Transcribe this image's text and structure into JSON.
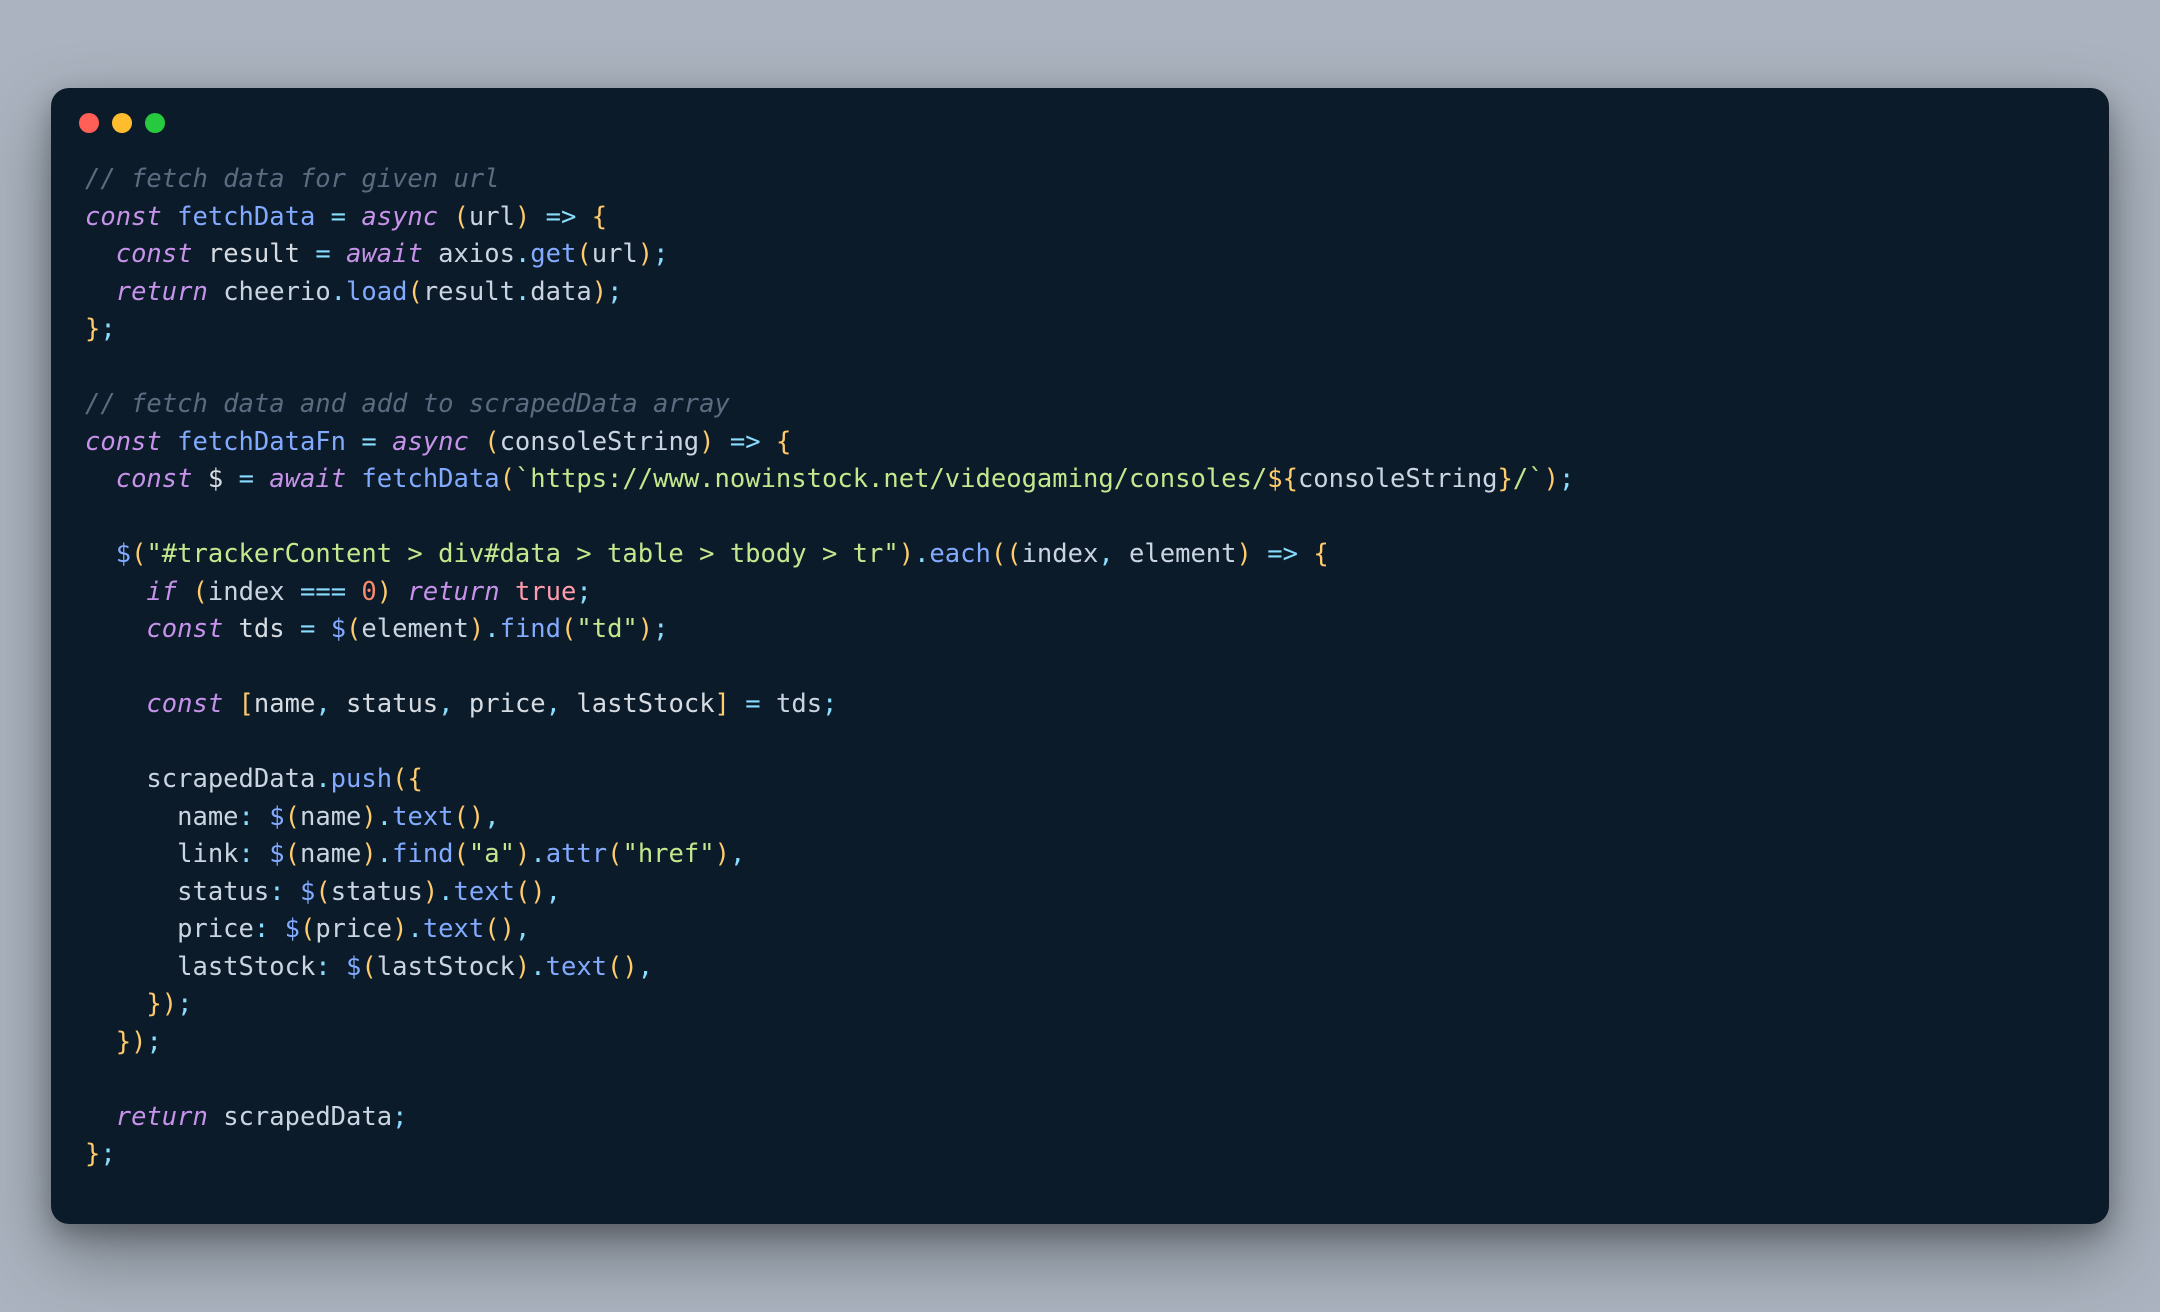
{
  "window": {
    "traffic_lights": [
      "close",
      "minimize",
      "zoom"
    ]
  },
  "code": {
    "c1": "// fetch data for given url",
    "kw_const": "const",
    "kw_async": "async",
    "kw_await": "await",
    "kw_return": "return",
    "kw_if": "if",
    "fn_fetchData": "fetchData",
    "var_url": "url",
    "arrow": "=>",
    "var_result": "result",
    "id_axios": "axios",
    "m_get": "get",
    "id_cheerio": "cheerio",
    "m_load": "load",
    "prop_data": "data",
    "c2": "// fetch data and add to scrapedData array",
    "fn_fetchDataFn": "fetchDataFn",
    "var_consoleString": "consoleString",
    "var_dollar": "$",
    "str_url_a": "https://www.nowinstock.net/videogaming/consoles/",
    "str_url_b": "/",
    "str_selector": "\"#trackerContent > div#data > table > tbody > tr\"",
    "m_each": "each",
    "var_index": "index",
    "var_element": "element",
    "eqeqeq": "===",
    "num_zero": "0",
    "bool_true": "true",
    "var_tds": "tds",
    "m_find": "find",
    "str_td": "\"td\"",
    "destruct_name": "name",
    "destruct_status": "status",
    "destruct_price": "price",
    "destruct_lastStock": "lastStock",
    "id_scrapedData": "scrapedData",
    "m_push": "push",
    "m_text": "text",
    "str_a": "\"a\"",
    "m_attr": "attr",
    "str_href": "\"href\"",
    "prop_name": "name",
    "prop_link": "link",
    "prop_status": "status",
    "prop_price": "price",
    "prop_lastStock": "lastStock"
  }
}
